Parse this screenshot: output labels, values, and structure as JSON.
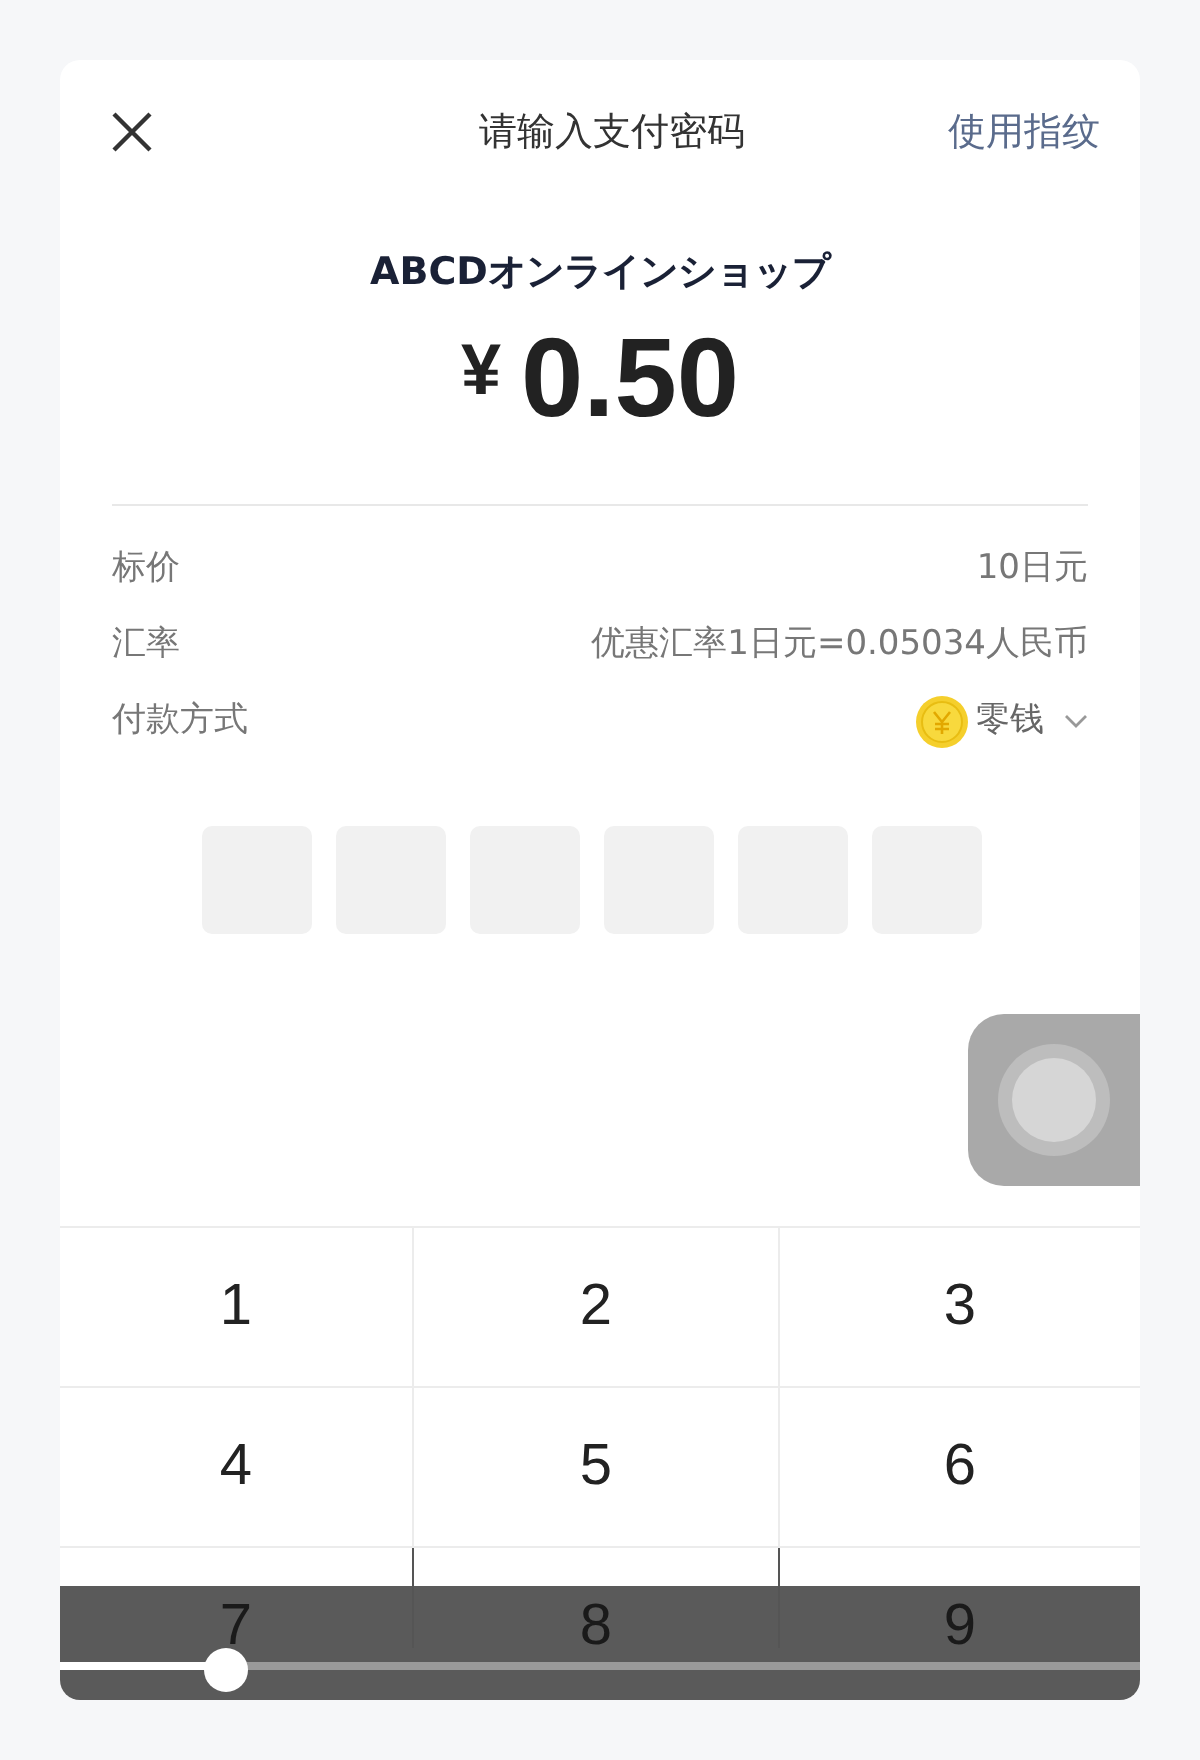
{
  "header": {
    "title": "请输入支付密码",
    "action": "使用指纹"
  },
  "merchant": "ABCDオンラインショップ",
  "amount": {
    "currency": "¥",
    "value": "0.50"
  },
  "details": [
    {
      "kind": "text",
      "label": "标价",
      "value": "10日元"
    },
    {
      "kind": "text",
      "label": "汇率",
      "value": "优惠汇率1日元=0.05034人民币"
    },
    {
      "kind": "select",
      "label": "付款方式",
      "value": "零钱"
    }
  ],
  "pin_slots": [
    {
      "filled": false
    },
    {
      "filled": false
    },
    {
      "filled": false
    },
    {
      "filled": false
    },
    {
      "filled": false
    },
    {
      "filled": false
    }
  ],
  "keypad": [
    "1",
    "2",
    "3",
    "4",
    "5",
    "6",
    "7",
    "8",
    "9"
  ],
  "video_controls": {
    "level": 0.154
  }
}
